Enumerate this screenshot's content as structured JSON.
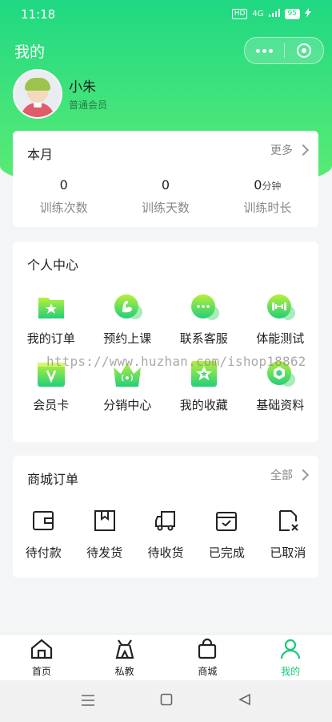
{
  "status_bar": {
    "time": "11:18",
    "hd": "HD",
    "net": "4G",
    "battery": "95"
  },
  "title_bar": {
    "title": "我的"
  },
  "profile": {
    "name": "小朱",
    "level": "普通会员"
  },
  "month_card": {
    "title": "本月",
    "more": "更多",
    "stats": [
      {
        "value": "0",
        "unit": "",
        "label": "训练次数"
      },
      {
        "value": "0",
        "unit": "",
        "label": "训练天数"
      },
      {
        "value": "0",
        "unit": "分钟",
        "label": "训练时长"
      }
    ]
  },
  "personal_center": {
    "title": "个人中心",
    "items": [
      {
        "label": "我的订单",
        "icon": "star-folder-icon"
      },
      {
        "label": "预约上课",
        "icon": "arm-muscle-icon"
      },
      {
        "label": "联系客服",
        "icon": "chat-bubble-icon"
      },
      {
        "label": "体能测试",
        "icon": "dumbbell-icon"
      },
      {
        "label": "会员卡",
        "icon": "vip-card-icon"
      },
      {
        "label": "分销中心",
        "icon": "crown-icon"
      },
      {
        "label": "我的收藏",
        "icon": "star-box-icon"
      },
      {
        "label": "基础资料",
        "icon": "hexagon-icon"
      }
    ]
  },
  "watermark": "https://www.huzhan.com/ishop18862",
  "mall_orders": {
    "title": "商城订单",
    "all": "全部",
    "items": [
      {
        "label": "待付款",
        "icon": "wallet-icon"
      },
      {
        "label": "待发货",
        "icon": "package-box-icon"
      },
      {
        "label": "待收货",
        "icon": "delivery-truck-icon"
      },
      {
        "label": "已完成",
        "icon": "calendar-check-icon"
      },
      {
        "label": "已取消",
        "icon": "document-cancel-icon"
      }
    ]
  },
  "tabbar": {
    "items": [
      {
        "label": "首页",
        "icon": "home-icon",
        "active": false
      },
      {
        "label": "私教",
        "icon": "coach-icon",
        "active": false
      },
      {
        "label": "商城",
        "icon": "shopping-bag-icon",
        "active": false
      },
      {
        "label": "我的",
        "icon": "person-icon",
        "active": true
      }
    ]
  },
  "colors": {
    "brand": "#1fd882",
    "accent_text": "#19c777",
    "background": "#f4f5f7"
  }
}
